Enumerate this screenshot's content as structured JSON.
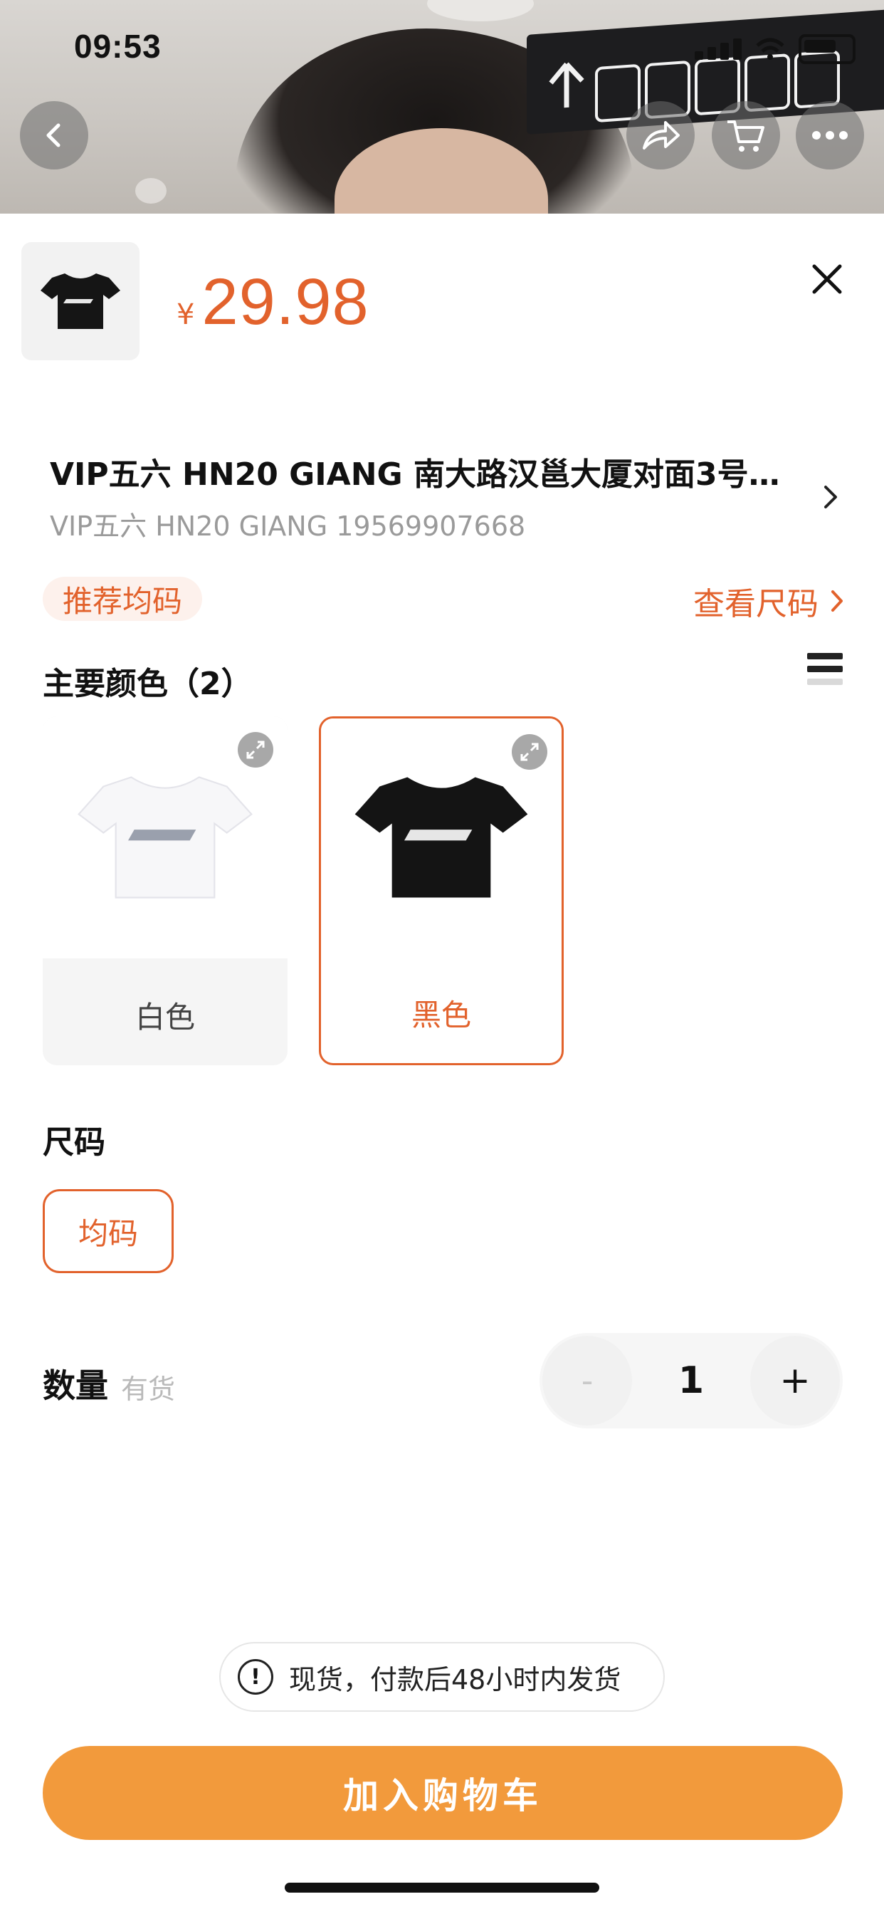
{
  "status_bar": {
    "time": "09:53"
  },
  "product": {
    "currency": "¥",
    "price": "29.98"
  },
  "address": {
    "line1": "VIP五六 HN20 GIANG   南大路汉邕大厦对面3号…",
    "line2": "VIP五六  HN20 GIANG 19569907668"
  },
  "size_tag": "推荐均码",
  "size_link": "查看尺码",
  "colors": {
    "title": "主要颜色（2）",
    "options": [
      {
        "label": "白色",
        "selected": false
      },
      {
        "label": "黑色",
        "selected": true
      }
    ]
  },
  "size": {
    "title": "尺码",
    "options": [
      {
        "label": "均码",
        "selected": true
      }
    ]
  },
  "quantity": {
    "title": "数量",
    "stock": "有货",
    "minus": "-",
    "value": "1",
    "plus": "+"
  },
  "shipping_note": {
    "icon": "!",
    "text": "现货，付款后48小时内发货"
  },
  "cart_button": "加入购物车",
  "colors_palette": {
    "accent": "#e2622c",
    "button": "#f29a3c"
  }
}
